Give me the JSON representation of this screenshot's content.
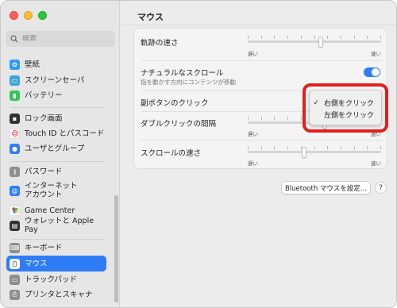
{
  "search": {
    "placeholder": "検索"
  },
  "sidebar": {
    "items": [
      {
        "label": "壁紙",
        "icon": "wallpaper-icon",
        "color": "#2f9bf7"
      },
      {
        "label": "スクリーンセーバ",
        "icon": "screensaver-icon",
        "color": "#3aa6d9"
      },
      {
        "label": "バッテリー",
        "icon": "battery-icon",
        "color": "#34c759"
      },
      {
        "label": "ロック画面",
        "icon": "lock-screen-icon",
        "color": "#333333"
      },
      {
        "label": "Touch ID とパスコード",
        "icon": "touch-id-icon",
        "color": "#ff4f5a"
      },
      {
        "label": "ユーザとグループ",
        "icon": "users-groups-icon",
        "color": "#2f7df6"
      },
      {
        "label": "パスワード",
        "icon": "key-icon",
        "color": "#8e8e8e"
      },
      {
        "label": "インターネット アカウント",
        "label_line1": "インターネット",
        "label_line2": "アカウント",
        "icon": "at-sign-icon",
        "color": "#2f7df6"
      },
      {
        "label": "Game Center",
        "icon": "game-center-icon",
        "color": "#ffffff"
      },
      {
        "label": "ウォレットと Apple Pay",
        "icon": "wallet-icon",
        "color": "#333333"
      },
      {
        "label": "キーボード",
        "icon": "keyboard-icon",
        "color": "#8e8e8e"
      },
      {
        "label": "マウス",
        "icon": "mouse-icon",
        "color": "#ffffff",
        "active": true
      },
      {
        "label": "トラックパッド",
        "icon": "trackpad-icon",
        "color": "#8e8e8e"
      },
      {
        "label": "プリンタとスキャナ",
        "icon": "printer-icon",
        "color": "#8e8e8e"
      }
    ]
  },
  "main": {
    "title": "マウス",
    "tracking_speed": {
      "label": "軌跡の速さ",
      "slow": "遅い",
      "fast": "速い",
      "value": 0.55
    },
    "natural_scroll": {
      "label": "ナチュラルなスクロール",
      "sub": "指を動かす方向にコンテンツが移動",
      "on": true
    },
    "secondary_click": {
      "label": "副ボタンのクリック"
    },
    "double_click": {
      "label": "ダブルクリックの間隔",
      "slow": "遅い",
      "fast": "速い",
      "value": 0.58
    },
    "scroll_speed": {
      "label": "スクロールの速さ",
      "slow": "遅い",
      "fast": "速い",
      "value": 0.42
    },
    "bluetooth_button": "Bluetooth マウスを設定...",
    "help_button": "?"
  },
  "popup": {
    "items": [
      {
        "label": "右側をクリック",
        "checked": true,
        "check": "✓"
      },
      {
        "label": "左側をクリック",
        "checked": false,
        "check": ""
      }
    ]
  },
  "colors": {
    "accent": "#2f7df6",
    "highlight": "#e21e1e"
  }
}
